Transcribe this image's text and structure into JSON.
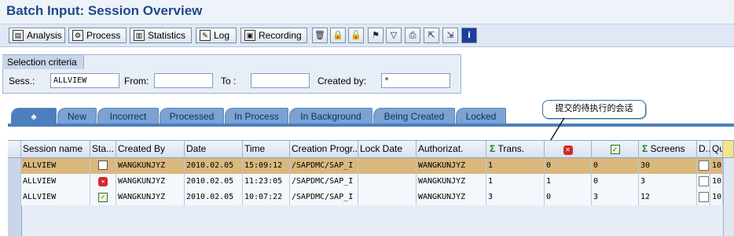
{
  "window": {
    "title": "Batch Input: Session Overview"
  },
  "toolbar": {
    "buttons": [
      {
        "label": "Analysis",
        "icon": "analysis-icon",
        "glyph": "▤"
      },
      {
        "label": "Process",
        "icon": "process-icon",
        "glyph": "⚙"
      },
      {
        "label": "Statistics",
        "icon": "statistics-icon",
        "glyph": "▥"
      },
      {
        "label": "Log",
        "icon": "log-icon",
        "glyph": "✎"
      },
      {
        "label": "Recording",
        "icon": "recording-icon",
        "glyph": "▣"
      }
    ],
    "icons": [
      {
        "name": "delete-icon",
        "glyph": "🗑"
      },
      {
        "name": "lock-icon",
        "glyph": "🔒"
      },
      {
        "name": "unlock-icon",
        "glyph": "🔓"
      },
      {
        "name": "flag-icon",
        "glyph": "⚑"
      },
      {
        "name": "filter-icon",
        "glyph": "▽"
      },
      {
        "name": "print-icon",
        "glyph": "⎙"
      },
      {
        "name": "export-icon",
        "glyph": "⇱"
      },
      {
        "name": "import-icon",
        "glyph": "⇲"
      },
      {
        "name": "info-icon",
        "glyph": "i"
      }
    ]
  },
  "selection": {
    "title": "Selection criteria",
    "session_label": "Sess.:",
    "session_value": "ALLVIEW",
    "from_label": "From:",
    "from_value": "",
    "to_label": "To :",
    "to_value": "",
    "created_by_label": "Created by:",
    "created_by_value": "*"
  },
  "tabs": [
    {
      "label": "",
      "icon": "all-sessions-icon",
      "active": true
    },
    {
      "label": "New"
    },
    {
      "label": "Incorrect"
    },
    {
      "label": "Processed"
    },
    {
      "label": "In Process"
    },
    {
      "label": "In Background"
    },
    {
      "label": "Being Created"
    },
    {
      "label": "Locked"
    }
  ],
  "callout": {
    "text": "提交的待执行的会话"
  },
  "table": {
    "headers": [
      "Session name",
      "Sta...",
      "Created By",
      "Date",
      "Time",
      "Creation Progr...",
      "Lock Date",
      "Authorizat.",
      "Trans.",
      "",
      "",
      "Screens",
      "D...",
      "Qu"
    ],
    "rows": [
      {
        "session": "ALLVIEW",
        "status": "new",
        "created_by": "WANGKUNJYZ",
        "date": "2010.02.05",
        "time": "15:09:12",
        "program": "/SAPDMC/SAP_I",
        "lock_date": "",
        "auth": "WANGKUNJYZ",
        "trans": "1",
        "err": "0",
        "ok": "0",
        "screens": "30",
        "q": "10"
      },
      {
        "session": "ALLVIEW",
        "status": "error",
        "created_by": "WANGKUNJYZ",
        "date": "2010.02.05",
        "time": "11:23:05",
        "program": "/SAPDMC/SAP_I",
        "lock_date": "",
        "auth": "WANGKUNJYZ",
        "trans": "1",
        "err": "1",
        "ok": "0",
        "screens": "3",
        "q": "10"
      },
      {
        "session": "ALLVIEW",
        "status": "processed",
        "created_by": "WANGKUNJYZ",
        "date": "2010.02.05",
        "time": "10:07:22",
        "program": "/SAPDMC/SAP_I",
        "lock_date": "",
        "auth": "WANGKUNJYZ",
        "trans": "3",
        "err": "0",
        "ok": "3",
        "screens": "12",
        "q": "10"
      }
    ]
  },
  "colors": {
    "title": "#1f4a86",
    "tab": "#7aa3d3",
    "highlight_row": "#d9b77d"
  }
}
